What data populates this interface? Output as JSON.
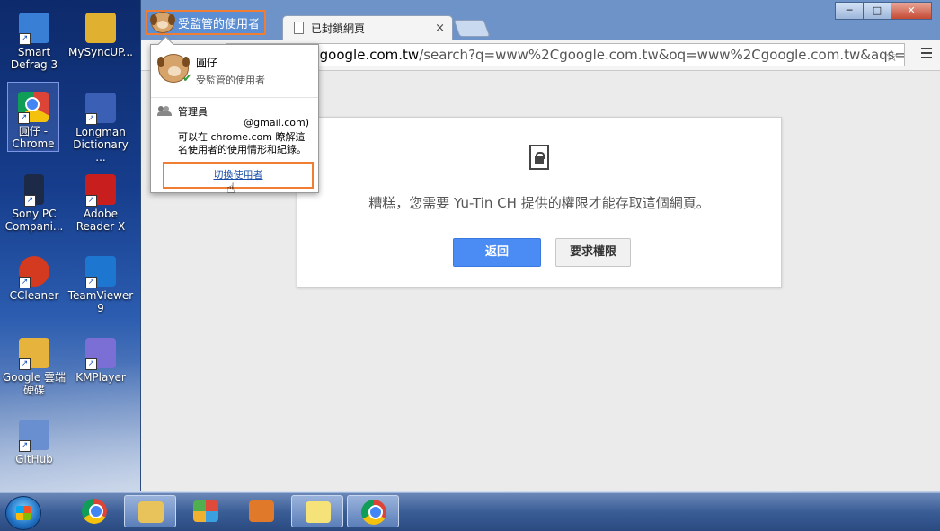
{
  "desktop": {
    "icons": [
      {
        "label": "Smart Defrag 3",
        "color": "#3a7fd6"
      },
      {
        "label": "MySyncUP...",
        "color": "#e0b030"
      },
      {
        "label": "圓仔 - Chrome",
        "color": "#db4437"
      },
      {
        "label": "Longman Dictionary ...",
        "color": "#3b5fb4"
      },
      {
        "label": "Sony PC Compani...",
        "color": "#1c2a48"
      },
      {
        "label": "Adobe Reader X",
        "color": "#c81e1e"
      },
      {
        "label": "CCleaner",
        "color": "#d33a1f"
      },
      {
        "label": "TeamViewer 9",
        "color": "#1d77d1"
      },
      {
        "label": "Google 雲端硬碟",
        "color": "#e6b43c"
      },
      {
        "label": "KMPlayer",
        "color": "#7b6fd6"
      },
      {
        "label": "GitHub",
        "color": "#6a8fd0"
      }
    ]
  },
  "browser": {
    "profile_button": "受監管的使用者",
    "tab_title": "已封鎖網頁",
    "tab_close": "×",
    "window_buttons": {
      "minimize": "─",
      "maximize": "□",
      "close": "✕"
    },
    "url_host": "w.google.com.tw",
    "url_rest": "/search?q=www%2Cgoogle.com.tw&oq=www%2Cgoogle.com.tw&aqs=",
    "star": "☆"
  },
  "blocked_page": {
    "message": "糟糕，您需要 Yu-Tin CH 提供的權限才能存取這個網頁。",
    "back_button": "返回",
    "request_button": "要求權限"
  },
  "profile_popup": {
    "name": "圓仔",
    "status": "受監管的使用者",
    "admin_label": "管理員",
    "admin_email": "@gmail.com)",
    "info": "可以在 chrome.com 瞭解這名使用者的使用情形和紀錄。",
    "switch_user": "切換使用者"
  },
  "taskbar": {
    "items": [
      "start",
      "chrome",
      "explorer",
      "apps",
      "media",
      "sticky-notes",
      "chrome-profile"
    ]
  }
}
